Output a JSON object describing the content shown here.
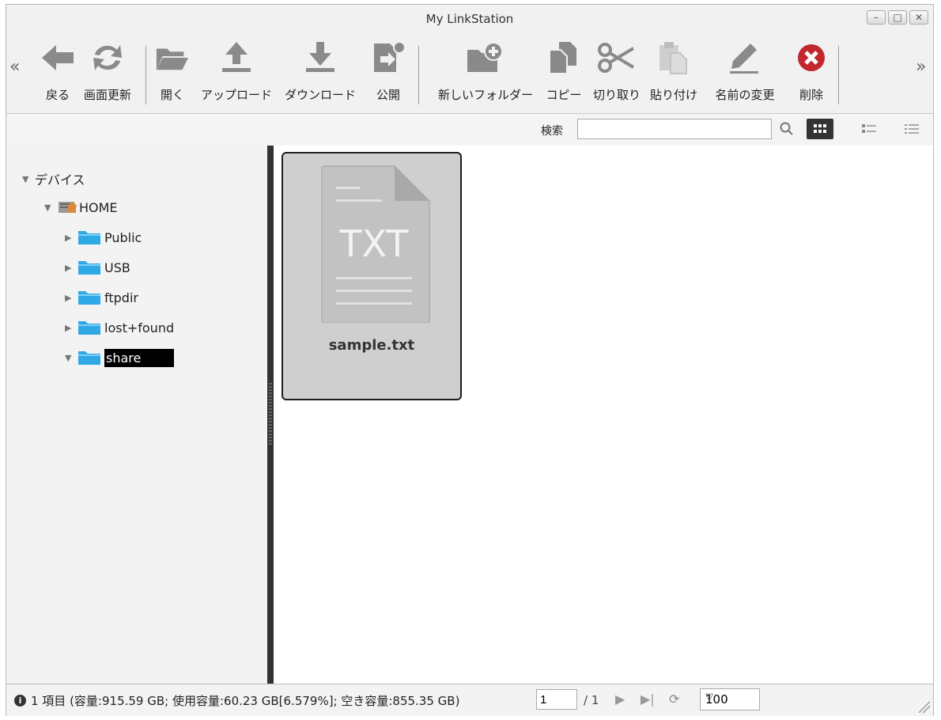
{
  "window": {
    "title": "My LinkStation"
  },
  "toolbar": {
    "scroll_left": "«",
    "scroll_right": "»",
    "items": [
      {
        "label": "戻る",
        "icon": "back-arrow-icon"
      },
      {
        "label": "画面更新",
        "icon": "refresh-icon"
      },
      {
        "label": "開く",
        "icon": "open-folder-icon"
      },
      {
        "label": "アップロード",
        "icon": "upload-icon"
      },
      {
        "label": "ダウンロード",
        "icon": "download-icon"
      },
      {
        "label": "公開",
        "icon": "publish-icon"
      },
      {
        "label": "新しいフォルダー",
        "icon": "new-folder-icon"
      },
      {
        "label": "コピー",
        "icon": "copy-icon"
      },
      {
        "label": "切り取り",
        "icon": "cut-icon"
      },
      {
        "label": "貼り付け",
        "icon": "paste-icon"
      },
      {
        "label": "名前の変更",
        "icon": "rename-icon"
      },
      {
        "label": "削除",
        "icon": "delete-icon"
      }
    ]
  },
  "search": {
    "label": "検索",
    "value": ""
  },
  "tree": {
    "root": "デバイス",
    "home": "HOME",
    "folders": [
      "Public",
      "USB",
      "ftpdir",
      "lost+found",
      "share"
    ],
    "selected": "share"
  },
  "files": [
    {
      "name": "sample.txt",
      "type_label": "TXT"
    }
  ],
  "status": {
    "text": "1 項目 (容量:915.59 GB; 使用容量:60.23 GB[6.579%]; 空き容量:855.35 GB)",
    "page": "1",
    "page_total": "/ 1",
    "page_size": "100"
  },
  "colors": {
    "folder": "#2fa8e6",
    "delete": "#c1272d",
    "selection": "#000000"
  }
}
